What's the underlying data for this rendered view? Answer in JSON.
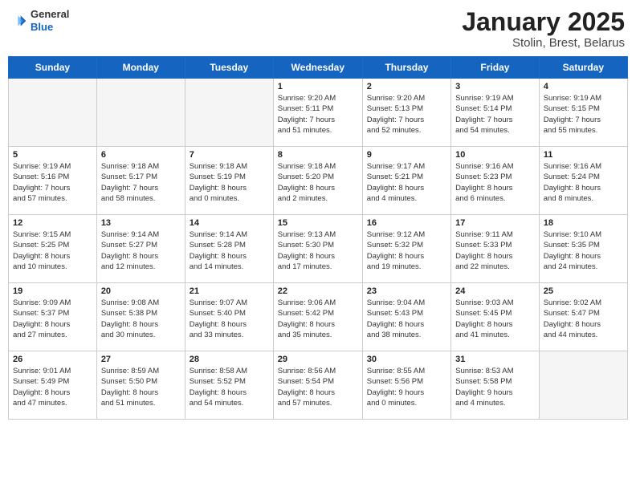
{
  "header": {
    "logo": {
      "line1": "General",
      "line2": "Blue"
    },
    "title": "January 2025",
    "subtitle": "Stolin, Brest, Belarus"
  },
  "weekdays": [
    "Sunday",
    "Monday",
    "Tuesday",
    "Wednesday",
    "Thursday",
    "Friday",
    "Saturday"
  ],
  "weeks": [
    {
      "days": [
        {
          "num": "",
          "info": ""
        },
        {
          "num": "",
          "info": ""
        },
        {
          "num": "",
          "info": ""
        },
        {
          "num": "1",
          "info": "Sunrise: 9:20 AM\nSunset: 5:11 PM\nDaylight: 7 hours\nand 51 minutes."
        },
        {
          "num": "2",
          "info": "Sunrise: 9:20 AM\nSunset: 5:13 PM\nDaylight: 7 hours\nand 52 minutes."
        },
        {
          "num": "3",
          "info": "Sunrise: 9:19 AM\nSunset: 5:14 PM\nDaylight: 7 hours\nand 54 minutes."
        },
        {
          "num": "4",
          "info": "Sunrise: 9:19 AM\nSunset: 5:15 PM\nDaylight: 7 hours\nand 55 minutes."
        }
      ]
    },
    {
      "days": [
        {
          "num": "5",
          "info": "Sunrise: 9:19 AM\nSunset: 5:16 PM\nDaylight: 7 hours\nand 57 minutes."
        },
        {
          "num": "6",
          "info": "Sunrise: 9:18 AM\nSunset: 5:17 PM\nDaylight: 7 hours\nand 58 minutes."
        },
        {
          "num": "7",
          "info": "Sunrise: 9:18 AM\nSunset: 5:19 PM\nDaylight: 8 hours\nand 0 minutes."
        },
        {
          "num": "8",
          "info": "Sunrise: 9:18 AM\nSunset: 5:20 PM\nDaylight: 8 hours\nand 2 minutes."
        },
        {
          "num": "9",
          "info": "Sunrise: 9:17 AM\nSunset: 5:21 PM\nDaylight: 8 hours\nand 4 minutes."
        },
        {
          "num": "10",
          "info": "Sunrise: 9:16 AM\nSunset: 5:23 PM\nDaylight: 8 hours\nand 6 minutes."
        },
        {
          "num": "11",
          "info": "Sunrise: 9:16 AM\nSunset: 5:24 PM\nDaylight: 8 hours\nand 8 minutes."
        }
      ]
    },
    {
      "days": [
        {
          "num": "12",
          "info": "Sunrise: 9:15 AM\nSunset: 5:25 PM\nDaylight: 8 hours\nand 10 minutes."
        },
        {
          "num": "13",
          "info": "Sunrise: 9:14 AM\nSunset: 5:27 PM\nDaylight: 8 hours\nand 12 minutes."
        },
        {
          "num": "14",
          "info": "Sunrise: 9:14 AM\nSunset: 5:28 PM\nDaylight: 8 hours\nand 14 minutes."
        },
        {
          "num": "15",
          "info": "Sunrise: 9:13 AM\nSunset: 5:30 PM\nDaylight: 8 hours\nand 17 minutes."
        },
        {
          "num": "16",
          "info": "Sunrise: 9:12 AM\nSunset: 5:32 PM\nDaylight: 8 hours\nand 19 minutes."
        },
        {
          "num": "17",
          "info": "Sunrise: 9:11 AM\nSunset: 5:33 PM\nDaylight: 8 hours\nand 22 minutes."
        },
        {
          "num": "18",
          "info": "Sunrise: 9:10 AM\nSunset: 5:35 PM\nDaylight: 8 hours\nand 24 minutes."
        }
      ]
    },
    {
      "days": [
        {
          "num": "19",
          "info": "Sunrise: 9:09 AM\nSunset: 5:37 PM\nDaylight: 8 hours\nand 27 minutes."
        },
        {
          "num": "20",
          "info": "Sunrise: 9:08 AM\nSunset: 5:38 PM\nDaylight: 8 hours\nand 30 minutes."
        },
        {
          "num": "21",
          "info": "Sunrise: 9:07 AM\nSunset: 5:40 PM\nDaylight: 8 hours\nand 33 minutes."
        },
        {
          "num": "22",
          "info": "Sunrise: 9:06 AM\nSunset: 5:42 PM\nDaylight: 8 hours\nand 35 minutes."
        },
        {
          "num": "23",
          "info": "Sunrise: 9:04 AM\nSunset: 5:43 PM\nDaylight: 8 hours\nand 38 minutes."
        },
        {
          "num": "24",
          "info": "Sunrise: 9:03 AM\nSunset: 5:45 PM\nDaylight: 8 hours\nand 41 minutes."
        },
        {
          "num": "25",
          "info": "Sunrise: 9:02 AM\nSunset: 5:47 PM\nDaylight: 8 hours\nand 44 minutes."
        }
      ]
    },
    {
      "days": [
        {
          "num": "26",
          "info": "Sunrise: 9:01 AM\nSunset: 5:49 PM\nDaylight: 8 hours\nand 47 minutes."
        },
        {
          "num": "27",
          "info": "Sunrise: 8:59 AM\nSunset: 5:50 PM\nDaylight: 8 hours\nand 51 minutes."
        },
        {
          "num": "28",
          "info": "Sunrise: 8:58 AM\nSunset: 5:52 PM\nDaylight: 8 hours\nand 54 minutes."
        },
        {
          "num": "29",
          "info": "Sunrise: 8:56 AM\nSunset: 5:54 PM\nDaylight: 8 hours\nand 57 minutes."
        },
        {
          "num": "30",
          "info": "Sunrise: 8:55 AM\nSunset: 5:56 PM\nDaylight: 9 hours\nand 0 minutes."
        },
        {
          "num": "31",
          "info": "Sunrise: 8:53 AM\nSunset: 5:58 PM\nDaylight: 9 hours\nand 4 minutes."
        },
        {
          "num": "",
          "info": ""
        }
      ]
    }
  ]
}
